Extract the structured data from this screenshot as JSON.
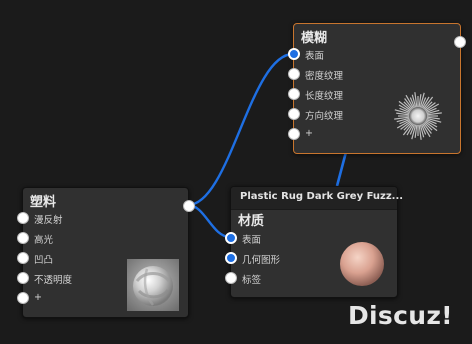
{
  "nodes": {
    "blur": {
      "title": "模糊",
      "ports": [
        "表面",
        "密度纹理",
        "长度纹理",
        "方向纹理",
        "+"
      ]
    },
    "plastic": {
      "title": "塑料",
      "ports": [
        "漫反射",
        "高光",
        "凹凸",
        "不透明度",
        "+"
      ]
    },
    "material": {
      "header": "Plastic Rug Dark Grey Fuzz...",
      "title": "材质",
      "ports": [
        "表面",
        "几何图形",
        "标签"
      ]
    }
  },
  "watermark": "Discuz!",
  "colors": {
    "background": "#1b1b1b",
    "node_body": "#303030",
    "selected_border": "#c8752e",
    "wire": "#1e6fe3",
    "socket": "#ffffff"
  },
  "icons": {
    "blur_preview": "radial-burst-icon",
    "plastic_preview": "plastic-sphere-icon",
    "material_preview": "skin-sphere-icon"
  }
}
